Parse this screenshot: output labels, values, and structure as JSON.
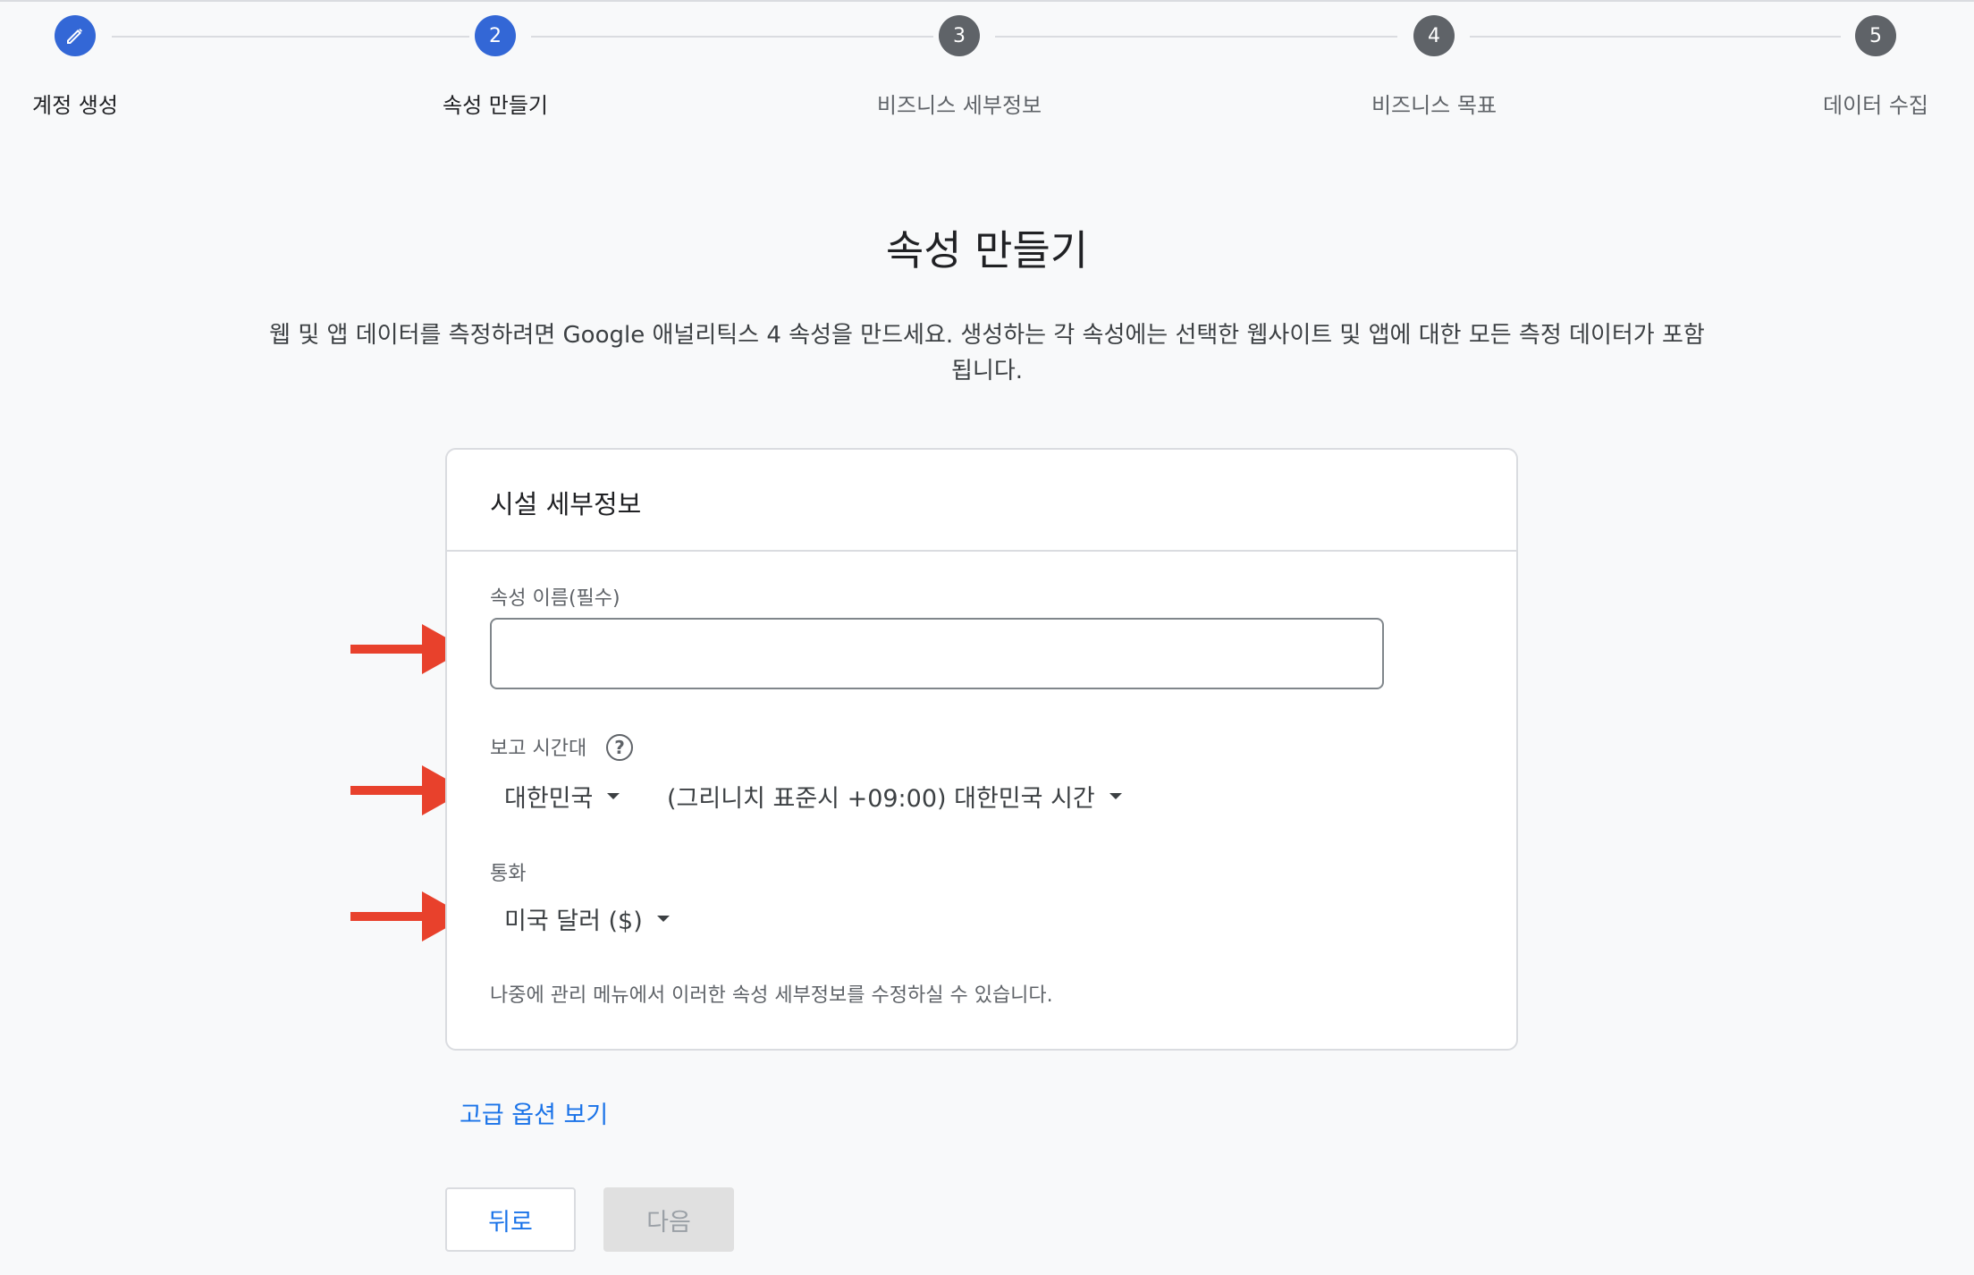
{
  "stepper": {
    "steps": [
      {
        "number": "",
        "label": "계정 생성",
        "state": "done",
        "icon": "pencil-icon"
      },
      {
        "number": "2",
        "label": "속성 만들기",
        "state": "active"
      },
      {
        "number": "3",
        "label": "비즈니스 세부정보",
        "state": "pending"
      },
      {
        "number": "4",
        "label": "비즈니스 목표",
        "state": "pending"
      },
      {
        "number": "5",
        "label": "데이터 수집",
        "state": "pending"
      }
    ]
  },
  "header": {
    "title": "속성 만들기",
    "description": "웹 및 앱 데이터를 측정하려면 Google 애널리틱스 4 속성을 만드세요. 생성하는 각 속성에는 선택한 웹사이트 및 앱에 대한 모든 측정 데이터가 포함됩니다."
  },
  "card": {
    "title": "시설 세부정보",
    "property_name": {
      "label": "속성 이름(필수)",
      "value": "",
      "placeholder": ""
    },
    "timezone": {
      "label": "보고 시간대",
      "help_icon": "?",
      "country": "대한민국",
      "zone": "(그리니치 표준시 +09:00) 대한민국 시간"
    },
    "currency": {
      "label": "통화",
      "value": "미국 달러 ($)"
    },
    "note": "나중에 관리 메뉴에서 이러한 속성 세부정보를 수정하실 수 있습니다."
  },
  "advanced_link": "고급 옵션 보기",
  "buttons": {
    "back": "뒤로",
    "next": "다음"
  },
  "colors": {
    "accent": "#1a73e8",
    "step_active": "#3367d6",
    "step_pending": "#5f6368",
    "arrow": "#e8412c"
  }
}
